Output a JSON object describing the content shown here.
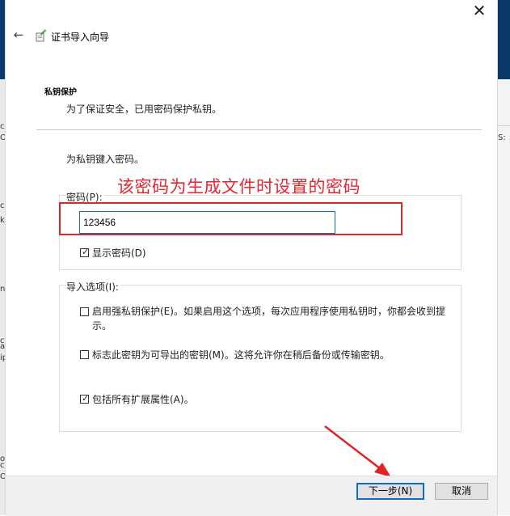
{
  "window": {
    "close_glyph": "✕"
  },
  "wizard": {
    "back_glyph": "←",
    "icon": "certificate-wizard-icon",
    "title": "证书导入向导"
  },
  "section": {
    "title": "私钥保护",
    "description": "为了保证安全，已用密码保护私钥。"
  },
  "prompt": "为私钥键入密码。",
  "annotation": "该密码为生成文件时设置的密码",
  "password": {
    "label": "密码(P):",
    "value": "123456",
    "show_password_label": "显示密码(D)",
    "show_password_checked": true
  },
  "import_options": {
    "label": "导入选项(I):",
    "items": [
      {
        "label": "启用强私钥保护(E)。如果启用这个选项，每次应用程序使用私钥时，你都会收到提示。",
        "checked": false
      },
      {
        "label": "标志此密钥为可导出的密钥(M)。这将允许你在稍后备份或传输密钥。",
        "checked": false
      },
      {
        "label": "包括所有扩展属性(A)。",
        "checked": true
      }
    ]
  },
  "buttons": {
    "next": "下一步(N)",
    "cancel": "取消"
  },
  "background_fragments": {
    "left": [
      "c",
      "O:",
      "c",
      "k",
      "n",
      "c",
      "a",
      "ip",
      "o",
      "c",
      "O"
    ],
    "right": [
      "S:"
    ]
  },
  "colors": {
    "annotation_red": "#e8262f",
    "accent_blue": "#0a6fc4"
  }
}
